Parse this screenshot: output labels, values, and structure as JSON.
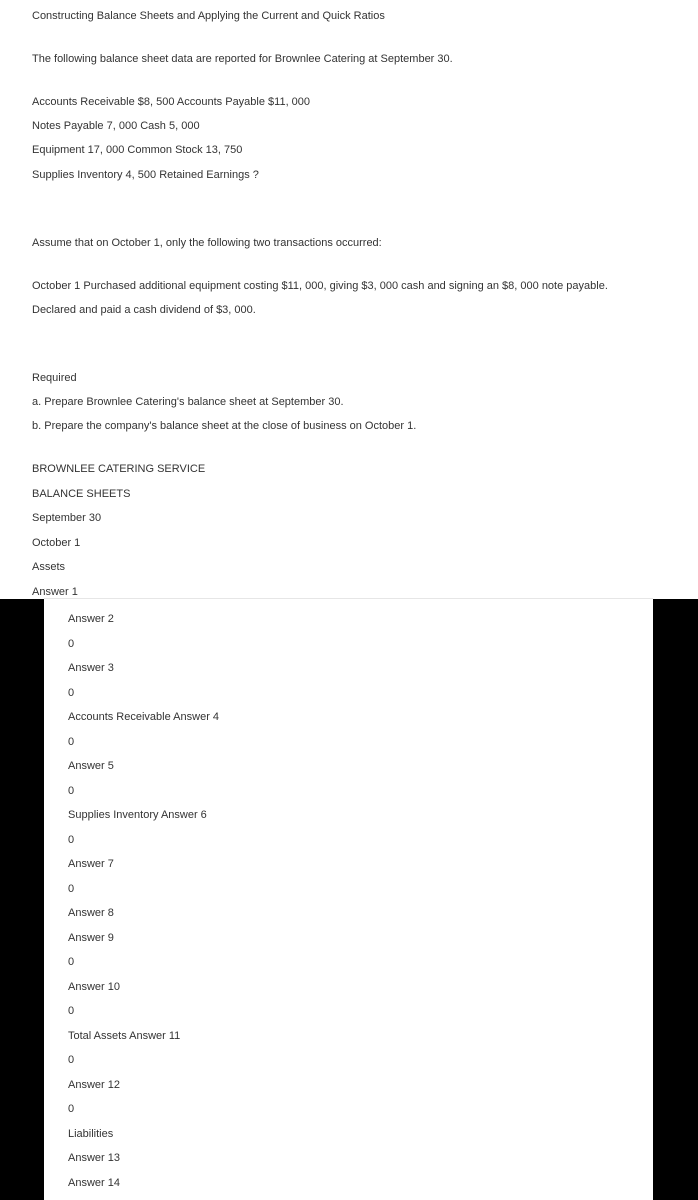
{
  "title": "Constructing Balance Sheets and Applying the Current and Quick Ratios",
  "intro": "The following balance sheet data are reported for Brownlee Catering at September 30.",
  "data_lines": [
    "Accounts Receivable $8, 500  Accounts Payable $11, 000",
    "Notes Payable 7, 000  Cash 5, 000",
    "Equipment 17, 000  Common Stock 13, 750",
    "Supplies Inventory 4, 500  Retained Earnings ?"
  ],
  "assume": "Assume that on October 1, only the following two transactions occurred:",
  "transactions": [
    "October 1 Purchased additional equipment costing $11, 000, giving $3, 000 cash and signing an $8, 000 note payable.",
    "Declared and paid a cash dividend of $3, 000."
  ],
  "required": {
    "heading": "Required",
    "items": [
      "a. Prepare Brownlee Catering's balance sheet at September 30.",
      "b. Prepare the company's balance sheet at the close of business on October 1."
    ]
  },
  "sheet": {
    "company": "BROWNLEE CATERING SERVICE",
    "heading": "BALANCE SHEETS",
    "date1": "September 30",
    "date2": "October 1",
    "section": "Assets",
    "answer1": "Answer 1"
  },
  "panel_lines": [
    "Answer 2",
    "0",
    "Answer 3",
    "0",
    "Accounts Receivable Answer 4",
    "0",
    "Answer 5",
    "0",
    "Supplies Inventory Answer 6",
    "0",
    "Answer 7",
    "0",
    "Answer 8",
    "Answer 9",
    "0",
    "Answer 10",
    "0",
    "Total Assets Answer 11",
    "0",
    "Answer 12",
    "0",
    "Liabilities",
    "Answer 13",
    "Answer 14"
  ]
}
